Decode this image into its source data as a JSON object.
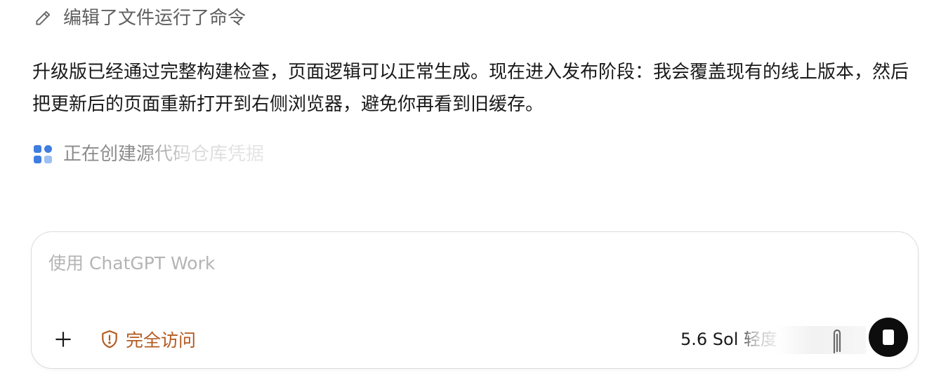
{
  "activity": {
    "edited_label": "编辑了文件运行了命令",
    "edited_icon": "pencil-icon",
    "creating_label": "正在创建源代码仓库凭据",
    "creating_icon": "apps-grid-icon"
  },
  "message": {
    "text": "升级版已经通过完整构建检查，页面逻辑可以正常生成。现在进入发布阶段：我会覆盖现有的线上版本，然后把更新后的页面重新打开到右侧浏览器，避免你再看到旧缓存。"
  },
  "composer": {
    "placeholder": "使用 ChatGPT Work",
    "value": "",
    "add_icon": "plus-icon",
    "access_label": "完全访问",
    "access_icon": "shield-alert-icon",
    "access_color": "#b45a1f",
    "model_label": "5.6 Sol 轻度",
    "attach_icon": "paperclip-icon",
    "stop_icon": "stop-icon"
  },
  "colors": {
    "accent_blue": "#4a86e8",
    "text_primary": "#1a1a1a",
    "text_muted": "#5f5f5f"
  }
}
